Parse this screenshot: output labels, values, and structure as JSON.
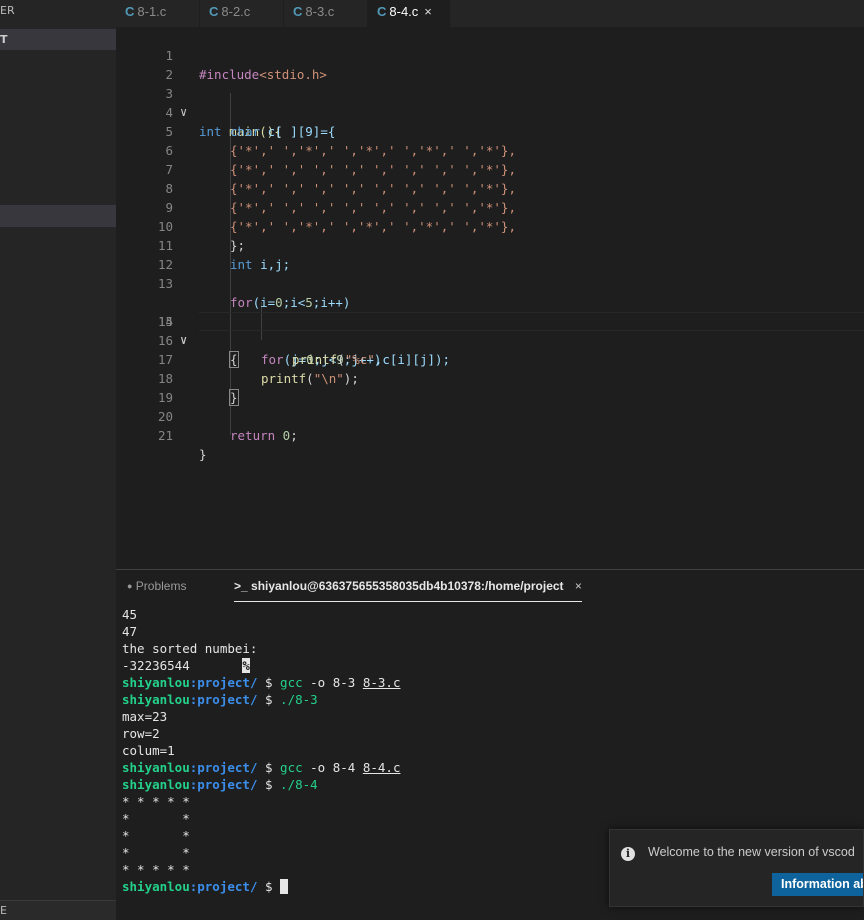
{
  "sidebar": {
    "title_fragment": "ER",
    "section_fragment": "T",
    "bottom_fragment": "E"
  },
  "tabs": [
    {
      "icon": "C",
      "label": "8-1.c"
    },
    {
      "icon": "C",
      "label": "8-2.c"
    },
    {
      "icon": "C",
      "label": "8-3.c"
    },
    {
      "icon": "C",
      "label": "8-4.c",
      "close": "×"
    }
  ],
  "editor": {
    "line_numbers": [
      "1",
      "2",
      "3",
      "4",
      "5",
      "6",
      "7",
      "8",
      "9",
      "10",
      "11",
      "12",
      "13",
      "14",
      "15",
      "16",
      "17",
      "18",
      "19",
      "20",
      "21"
    ],
    "fold_icon": "chevron-down-icon",
    "fold_glyph": "∨",
    "code": {
      "l1_pp": "#include",
      "l1_hdr": "<stdio.h>",
      "l3_kw": "int",
      "l3_rest": " main(){",
      "l4_kw": "char",
      "l4_rest": " c[ ][9]={",
      "l5": "{'*',' ','*',' ','*',' ','*',' ','*'},",
      "l6": "{'*',' ',' ',' ',' ',' ',' ',' ','*'},",
      "l7": "{'*',' ',' ',' ',' ',' ',' ',' ','*'},",
      "l8": "{'*',' ',' ',' ',' ',' ',' ',' ','*'},",
      "l9": "{'*',' ','*',' ','*',' ','*',' ','*'},",
      "l10": "};",
      "l11_kw": "int",
      "l11_rest": " i,j;",
      "l13_for": "for",
      "l13_a": "(i=",
      "l13_n0": "0",
      "l13_b": ";i<",
      "l13_n5": "5",
      "l13_c": ";i++)",
      "l14": "{",
      "l15_for": "for",
      "l15_a": "(j=",
      "l15_n0": "0",
      "l15_b": ";j<",
      "l15_n9": "9",
      "l15_c": ";j++)",
      "l16_fn": "printf",
      "l16_a": "(",
      "l16_str": "\"%c\"",
      "l16_b": ",c[i][j]);",
      "l17_fn": "printf",
      "l17_a": "(",
      "l17_str": "\"\\n\"",
      "l17_b": ");",
      "l18": "}",
      "l20_ret": "return",
      "l20_n": " 0",
      "l20_semi": ";",
      "l21": "}"
    }
  },
  "panel": {
    "problems_icon": "●",
    "problems_label": "Problems",
    "terminal_label": ">_ shiyanlou@636375655358035db4b10378:/home/project",
    "close": "×"
  },
  "terminal": {
    "user": "shiyanlou",
    "path": ":project/",
    "prompt": " $ ",
    "lines": {
      "o1": "45",
      "o2": "47",
      "o3": "the sorted numbei:",
      "o4_val": "-32236544",
      "o4_gap": "       ",
      "o4_pct": "%",
      "c1_bin": "gcc",
      "c1_args": " -o 8-3 ",
      "c1_file": "8-3.c",
      "c2_bin": "./8-3",
      "o5": "max=23",
      "o6": "row=2",
      "o7": "colum=1",
      "c3_bin": "gcc",
      "c3_args": " -o 8-4 ",
      "c3_file": "8-4.c",
      "c4_bin": "./8-4",
      "s1": "* * * * *",
      "s2": "*       *",
      "s3": "*       *",
      "s4": "*       *",
      "s5": "* * * * *"
    }
  },
  "notification": {
    "icon": "info-icon",
    "icon_glyph": "i",
    "message": "Welcome to the new version of vscod",
    "button": "Information ab"
  }
}
